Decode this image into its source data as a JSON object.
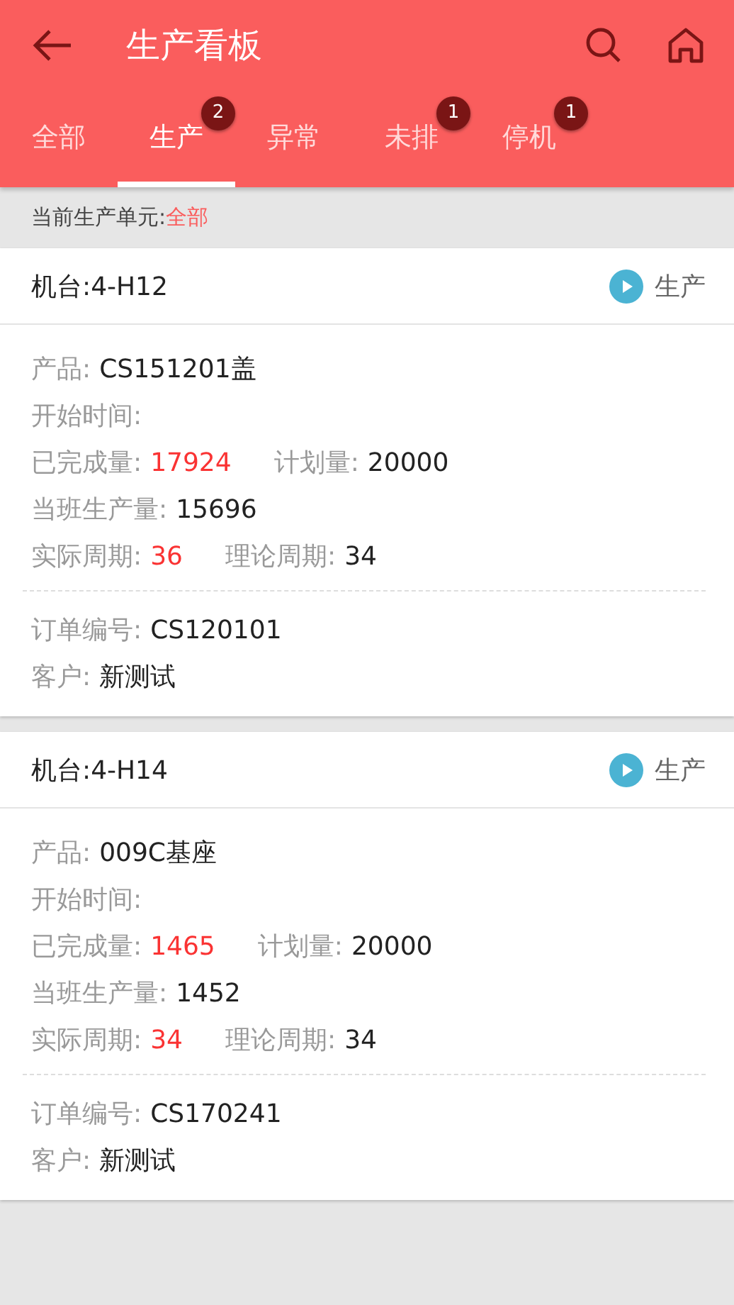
{
  "app_bar": {
    "title": "生产看板"
  },
  "tabs": [
    {
      "label": "全部",
      "selected": false
    },
    {
      "label": "生产",
      "selected": true,
      "badge": "2"
    },
    {
      "label": "异常",
      "selected": false
    },
    {
      "label": "未排",
      "selected": false,
      "badge": "1"
    },
    {
      "label": "停机",
      "selected": false,
      "badge": "1"
    }
  ],
  "unit_filter": {
    "label": "当前生产单元:",
    "value": "全部"
  },
  "machines": [
    {
      "machine": "机台:4-H12",
      "status": "生产",
      "details": [
        [
          {
            "label": "产品:",
            "value": "CS151201盖",
            "highlight": false
          }
        ],
        [
          {
            "label": "开始时间:"
          }
        ],
        [
          {
            "label": "已完成量:",
            "value": "17924",
            "highlight": true
          },
          {
            "label": "计划量:",
            "value": "20000",
            "highlight": false
          }
        ],
        [
          {
            "label": "当班生产量:",
            "value": "15696",
            "highlight": false
          }
        ],
        [
          {
            "label": "实际周期:",
            "value": "36",
            "highlight": true
          },
          {
            "label": "理论周期:",
            "value": "34",
            "highlight": false
          }
        ]
      ],
      "order": [
        [
          {
            "label": "订单编号:",
            "value": "CS120101",
            "highlight": false
          }
        ],
        [
          {
            "label": "客户:",
            "value": "新测试",
            "highlight": false
          }
        ]
      ]
    },
    {
      "machine": "机台:4-H14",
      "status": "生产",
      "details": [
        [
          {
            "label": "产品:",
            "value": "009C基座",
            "highlight": false
          }
        ],
        [
          {
            "label": "开始时间:"
          }
        ],
        [
          {
            "label": "已完成量:",
            "value": "1465",
            "highlight": true
          },
          {
            "label": "计划量:",
            "value": "20000",
            "highlight": false
          }
        ],
        [
          {
            "label": "当班生产量:",
            "value": "1452",
            "highlight": false
          }
        ],
        [
          {
            "label": "实际周期:",
            "value": "34",
            "highlight": true
          },
          {
            "label": "理论周期:",
            "value": "34",
            "highlight": false
          }
        ]
      ],
      "order": [
        [
          {
            "label": "订单编号:",
            "value": "CS170241",
            "highlight": false
          }
        ],
        [
          {
            "label": "客户:",
            "value": "新测试",
            "highlight": false
          }
        ]
      ]
    }
  ]
}
